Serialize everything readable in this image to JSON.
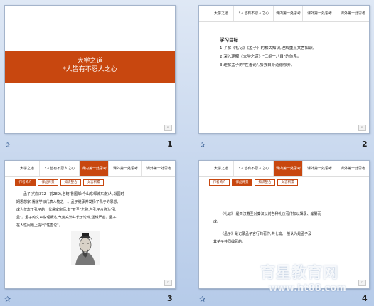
{
  "slide1": {
    "title": "大学之道",
    "subtitle": "*人皆有不忍人之心",
    "number": "1"
  },
  "slide2": {
    "tabs": [
      "大学之道",
      "*人皆有不忍人之心",
      "课内第一处思考",
      "课外第一处思考",
      "课外第一处思考"
    ],
    "heading": "学习目标",
    "items": [
      "1.了解《礼记》《孟子》的相关知识,理解重点文言知识。",
      "2.深入理解《大学之道》\"三纲\"\"八目\"的体系。",
      "3.理解孟子的\"性善论\",加强自身道德修养。"
    ],
    "number": "2"
  },
  "slide3": {
    "tabs": [
      "大学之道",
      "*人皆有不忍人之心",
      "课内第一处思考",
      "课外第一处思考",
      "课外第一处思考"
    ],
    "subtabs": [
      "作者简介",
      "作品背景",
      "知识整合",
      "文言积累"
    ],
    "paragraph": [
      "孟子(约前372—前289),名轲,鲁国邹(今山东邹城东南)人,战国时",
      "期思想家,儒家学派代表人物之一。孟子继承并发扬了孔子的思想,",
      "成为仅次于孔子的一代儒家宗师,有\"亚圣\"之称,与孔子合称为\"孔",
      "孟\"。孟子的文章说理畅达,气势充沛并长于论辩,逻辑严密。孟子",
      "在人性问题上提出\"性善论\"。"
    ],
    "number": "3"
  },
  "slide4": {
    "tabs": [
      "大学之道",
      "*人皆有不忍人之心",
      "课内第一处思考",
      "课外第一处思考",
      "课外第一处思考"
    ],
    "subtabs": [
      "作者简介",
      "作品背景",
      "知识整合",
      "文言积累"
    ],
    "para1": [
      "《礼记》,是西汉戴圣对秦汉以前各种礼仪著作加以辑录、编纂而",
      "成。"
    ],
    "para2": [
      "《孟子》是记录孟子言行的著作,共七篇,一般认为是孟子及",
      "其弟子共同编著的。"
    ],
    "number": "4"
  },
  "watermark": {
    "text": "育星教育网",
    "url": "www.ht88.com"
  },
  "colors": {
    "accent": "#c8470f"
  }
}
